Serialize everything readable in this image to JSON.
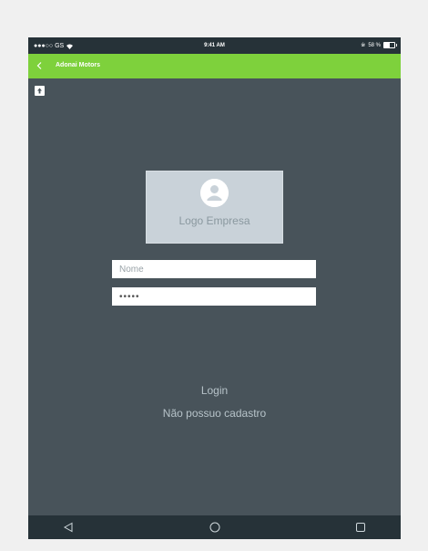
{
  "status_bar": {
    "carrier": "●●●○○ GS",
    "time": "9:41 AM",
    "battery": "58 %",
    "battery_level": 0.58
  },
  "app_bar": {
    "title": "Adonai Motors",
    "back_icon": "chevron-left-icon"
  },
  "upload_icon": "upload-icon",
  "logo": {
    "label": "Logo Empresa",
    "icon": "account-circle-icon"
  },
  "form": {
    "name_placeholder": "Nome",
    "password_value": "•••••"
  },
  "actions": {
    "login": "Login",
    "register": "Não possuo cadastro"
  },
  "nav_bar": {
    "back_icon": "triangle-back-icon",
    "home_icon": "circle-home-icon",
    "recents_icon": "square-recents-icon"
  },
  "colors": {
    "accent": "#7ed13c",
    "background": "#48535a",
    "bars": "#263238"
  }
}
